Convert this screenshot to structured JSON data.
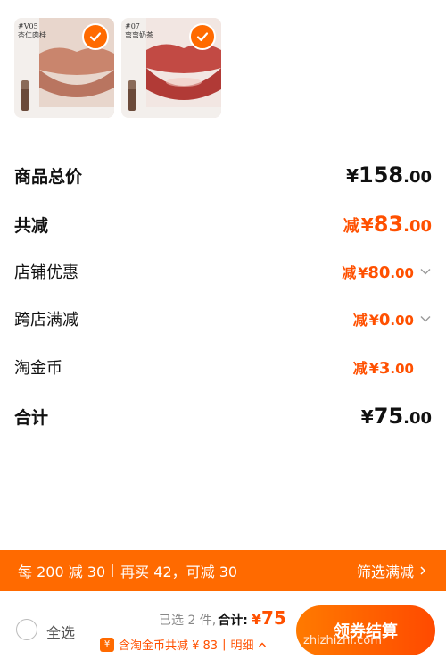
{
  "products": [
    {
      "shade": "#V05",
      "shade_name": "杏仁肉桂",
      "lip_color": "#c9856d",
      "selected": true
    },
    {
      "shade": "#07",
      "shade_name": "弯弯奶茶",
      "lip_color": "#c24a44",
      "selected": true
    }
  ],
  "price": {
    "rows": [
      {
        "label": "商品总价",
        "pre": "",
        "yen": "¥",
        "int": "158",
        "dec": ".00",
        "style": "black",
        "bold": true,
        "chevron": false
      },
      {
        "label": "共减",
        "pre": "减",
        "yen": "¥",
        "int": "83",
        "dec": ".00",
        "style": "orange",
        "bold": true,
        "chevron": false
      },
      {
        "label": "店铺优惠",
        "pre": "减",
        "yen": "¥",
        "int": "80",
        "dec": ".00",
        "style": "orange",
        "bold": false,
        "chevron": true
      },
      {
        "label": "跨店满减",
        "pre": "减",
        "yen": "¥",
        "int": "0",
        "dec": ".00",
        "style": "orange",
        "bold": false,
        "chevron": true
      },
      {
        "label": "淘金币",
        "pre": "减",
        "yen": "¥",
        "int": "3",
        "dec": ".00",
        "style": "orange",
        "bold": false,
        "chevron": false
      },
      {
        "label": "合计",
        "pre": "",
        "yen": "¥",
        "int": "75",
        "dec": ".00",
        "style": "black",
        "bold": true,
        "chevron": false
      }
    ]
  },
  "promo": {
    "rule": "每 200 减 30",
    "hint": "再买 42，可减 30",
    "filter": "筛选满减"
  },
  "bottom": {
    "select_all": "全选",
    "selected": "已选 2 件,",
    "total_label": "合计:",
    "total_yen": "¥",
    "total_int": "75",
    "coin_icon": "¥",
    "coins_text": "含淘金币共减 ¥ 83",
    "detail": "明细",
    "checkout": "领券结算"
  },
  "watermark": "zhizhizhi.com",
  "colors": {
    "accent": "#ff5000",
    "promo_bg": "#ff6a00"
  }
}
